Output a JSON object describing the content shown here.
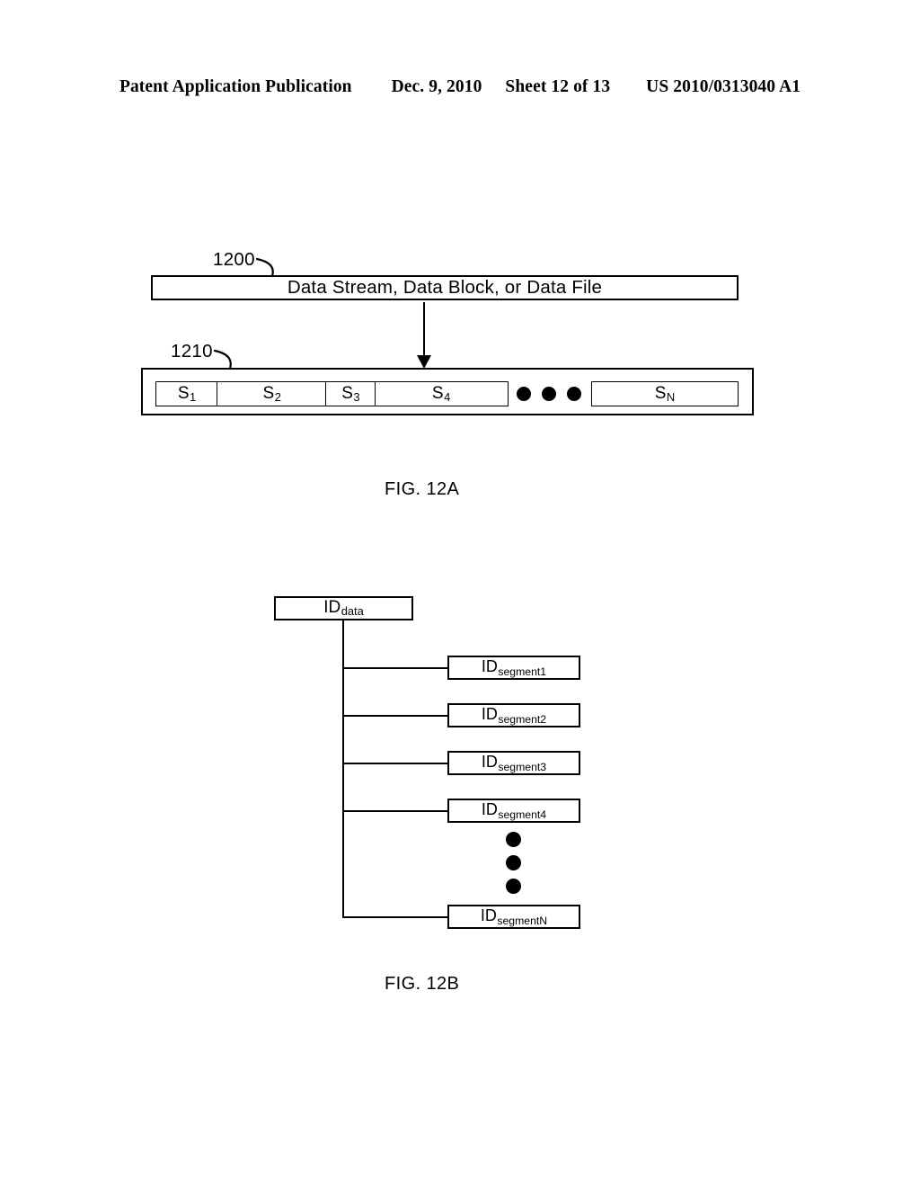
{
  "header": {
    "publication": "Patent Application Publication",
    "date": "Dec. 9, 2010",
    "sheet": "Sheet 12 of 13",
    "document_number": "US 2010/0313040 A1"
  },
  "fig12a": {
    "caption": "FIG. 12A",
    "source_box": {
      "label": "Data Stream, Data Block, or Data File",
      "reference_numeral": "1200"
    },
    "segment_container": {
      "reference_numeral": "1210",
      "segments": [
        {
          "base": "S",
          "subscript": "1"
        },
        {
          "base": "S",
          "subscript": "2"
        },
        {
          "base": "S",
          "subscript": "3"
        },
        {
          "base": "S",
          "subscript": "4"
        },
        {
          "base": "S",
          "subscript": "N"
        }
      ],
      "ellipsis_dot_count": 3
    }
  },
  "fig12b": {
    "caption": "FIG. 12B",
    "root": {
      "base": "ID",
      "subscript": "data"
    },
    "children": [
      {
        "base": "ID",
        "subscript": "segment1"
      },
      {
        "base": "ID",
        "subscript": "segment2"
      },
      {
        "base": "ID",
        "subscript": "segment3"
      },
      {
        "base": "ID",
        "subscript": "segment4"
      },
      {
        "base": "ID",
        "subscript": "segmentN"
      }
    ],
    "ellipsis_dot_count": 3
  },
  "colors": {
    "ink": "#000000",
    "paper": "#ffffff"
  }
}
